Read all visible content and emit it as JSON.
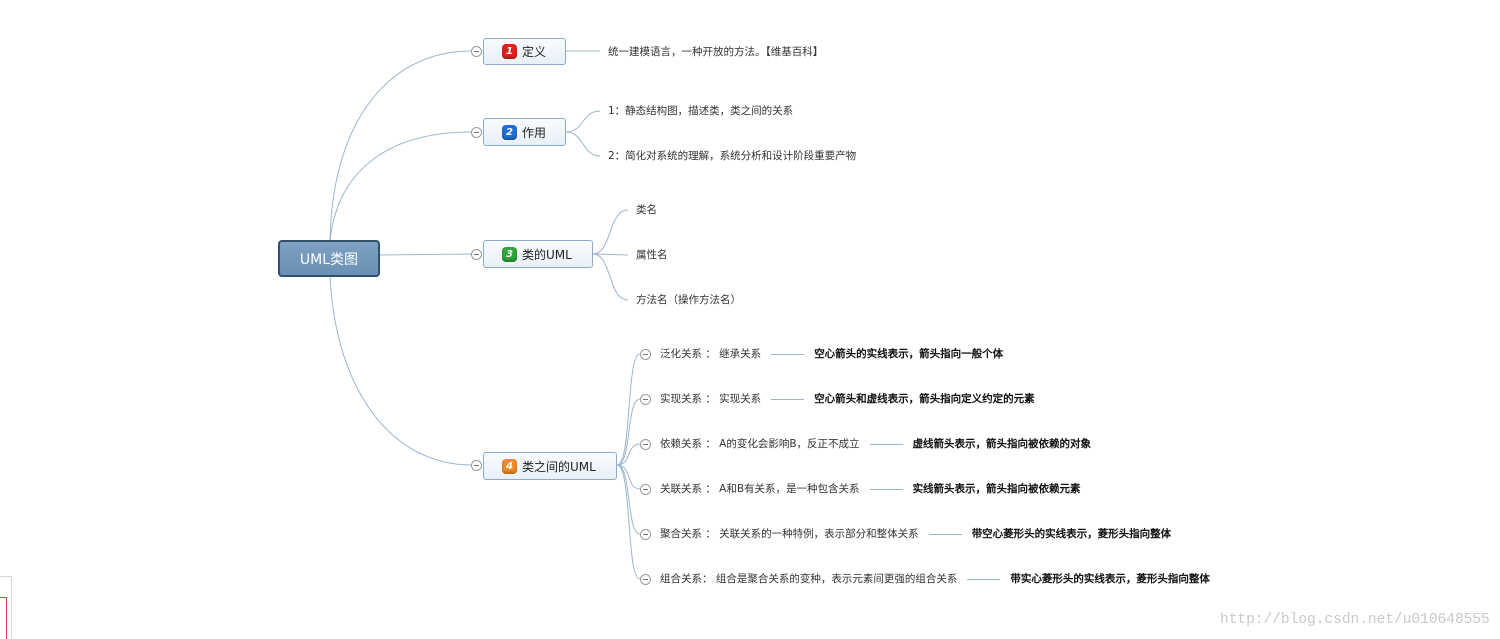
{
  "map": {
    "central_topic": "UML类图",
    "topics": [
      {
        "badge": "1",
        "badge_color": "#d8261d",
        "label": "定义",
        "subtopics": [
          "统一建模语言，一种开放的方法。【维基百科】"
        ]
      },
      {
        "badge": "2",
        "badge_color": "#1f6fd6",
        "label": "作用",
        "subtopics": [
          "1：静态结构图，描述类，类之间的关系",
          "2：简化对系统的理解，系统分析和设计阶段重要产物"
        ]
      },
      {
        "badge": "3",
        "badge_color": "#2ea43a",
        "label": "类的UML",
        "subtopics": [
          "类名",
          "属性名",
          "方法名（操作方法名）"
        ]
      },
      {
        "badge": "4",
        "badge_color": "#f08a24",
        "label": "类之间的UML",
        "relations": [
          {
            "label": "泛化关系 ： 继承关系",
            "note": "空心箭头的实线表示，箭头指向一般个体"
          },
          {
            "label": "实现关系 ： 实现关系",
            "note": "空心箭头和虚线表示，箭头指向定义约定的元素"
          },
          {
            "label": "依赖关系 ： A的变化会影响B，反正不成立",
            "note": "虚线箭头表示，箭头指向被依赖的对象"
          },
          {
            "label": "关联关系 ： A和B有关系，是一种包含关系",
            "note": "实线箭头表示，箭头指向被依赖元素"
          },
          {
            "label": "聚合关系 ： 关联关系的一种特例，表示部分和整体关系",
            "note": "带空心菱形头的实线表示，菱形头指向整体"
          },
          {
            "label": "组合关系： 组合是聚合关系的变种，表示元素间更强的组合关系",
            "note": "带实心菱形头的实线表示，菱形头指向整体"
          }
        ]
      }
    ]
  },
  "icons": {
    "collapse_toggle": "collapse-minus-icon"
  },
  "watermark": "http://blog.csdn.net/u010648555",
  "colors": {
    "connector": "#9db5cb",
    "central_fill": "#7097bc",
    "central_border": "#33506a",
    "topic_border": "#8aabc9",
    "background": "#ffffff"
  }
}
